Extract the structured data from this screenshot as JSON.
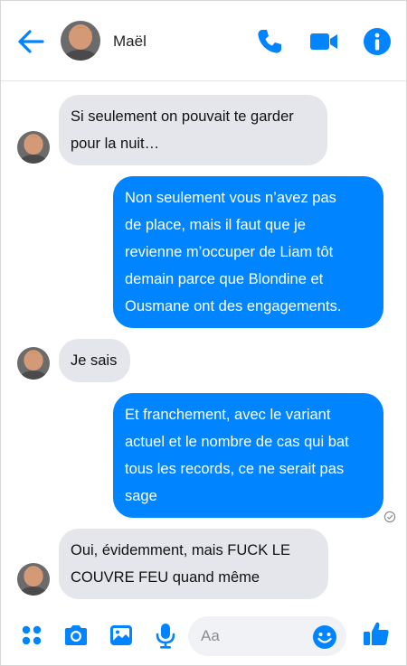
{
  "header": {
    "contact_name": "Maël",
    "icons": [
      "back-arrow-icon",
      "phone-icon",
      "video-camera-icon",
      "info-icon"
    ]
  },
  "messages": [
    {
      "direction": "incoming",
      "lines": [
        "Si seulement on pouvait te garder",
        "pour la nuit…"
      ]
    },
    {
      "direction": "outgoing",
      "lines": [
        "Non seulement vous n’avez pas",
        "de place, mais il faut que je",
        "revienne m’occuper de Liam tôt",
        "demain parce que Blondine et",
        "Ousmane ont des engagements."
      ]
    },
    {
      "direction": "incoming",
      "lines": [
        "Je sais"
      ]
    },
    {
      "direction": "outgoing",
      "lines": [
        "Et franchement, avec le variant",
        "actuel et le nombre de cas qui bat",
        "tous les records, ce ne serait pas",
        "sage"
      ]
    },
    {
      "direction": "incoming",
      "lines": [
        "Oui, évidemment, mais FUCK LE",
        "COUVRE FEU quand même"
      ]
    }
  ],
  "composer": {
    "placeholder": "Aa",
    "icons": [
      "apps-icon",
      "camera-icon",
      "image-icon",
      "microphone-icon",
      "emoji-icon",
      "thumbs-up-icon"
    ]
  },
  "colors": {
    "accent": "#0084ff",
    "incoming_bubble": "#e4e6eb",
    "outgoing_text": "#ffffff"
  }
}
